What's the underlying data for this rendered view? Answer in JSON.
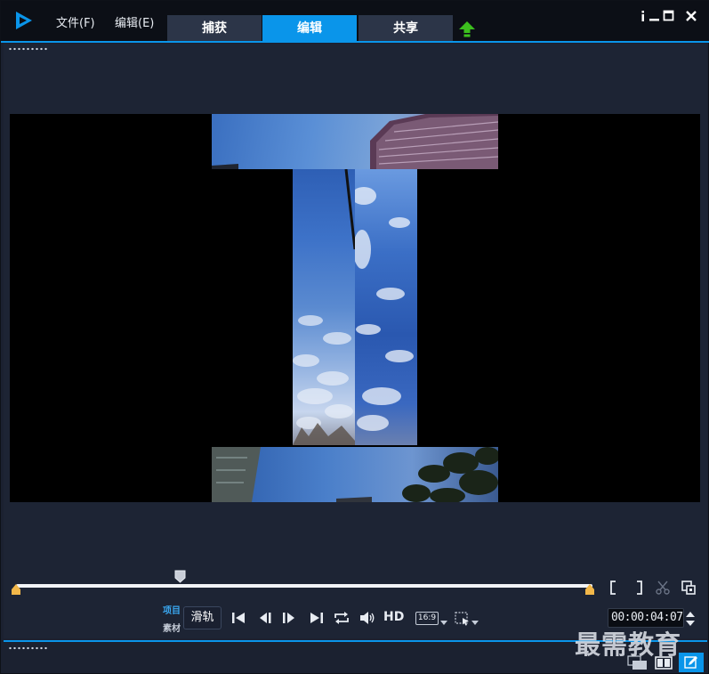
{
  "menu": {
    "file": "文件(F)",
    "edit": "编辑(E)"
  },
  "tabs": [
    {
      "label": "捕获",
      "active": false
    },
    {
      "label": "编辑",
      "active": true
    },
    {
      "label": "共享",
      "active": false
    }
  ],
  "window_controls": [
    "info-icon",
    "minimize-icon",
    "maximize-icon",
    "close-icon"
  ],
  "colors": {
    "accent": "#0a95ea",
    "upload_arrow": "#3cbf1e",
    "trim_marker": "#f2b749",
    "background": "#1b2130"
  },
  "player": {
    "mode_project": "项目",
    "mode_clip": "素材",
    "tooltip": "滑轨",
    "hd_label": "HD",
    "aspect_ratio": "16:9",
    "timecode": "00:00:04:07"
  },
  "watermark": "最需教育"
}
